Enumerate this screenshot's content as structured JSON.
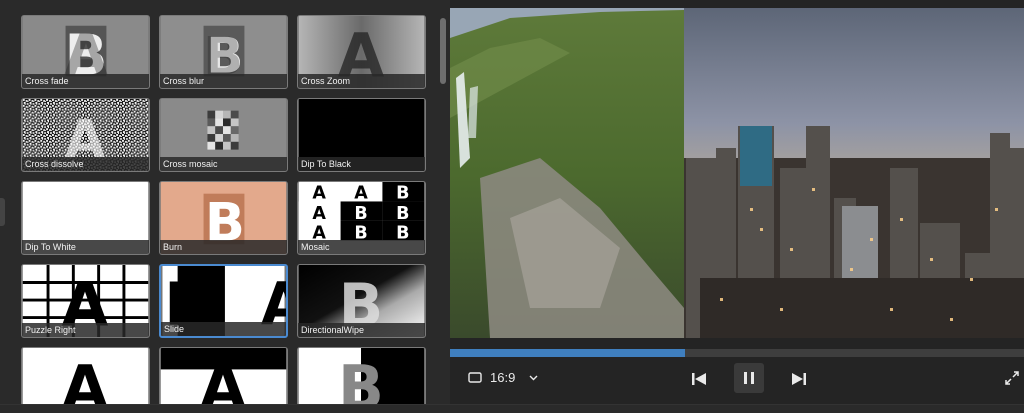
{
  "transitions": [
    {
      "label": "Cross fade",
      "selected": false
    },
    {
      "label": "Cross blur",
      "selected": false
    },
    {
      "label": "Cross Zoom",
      "selected": false
    },
    {
      "label": "Cross dissolve",
      "selected": false
    },
    {
      "label": "Cross mosaic",
      "selected": false
    },
    {
      "label": "Dip To Black",
      "selected": false
    },
    {
      "label": "Dip To White",
      "selected": false
    },
    {
      "label": "Burn",
      "selected": false
    },
    {
      "label": "Mosaic",
      "selected": false
    },
    {
      "label": "Puzzle Right",
      "selected": false
    },
    {
      "label": "Slide",
      "selected": true
    },
    {
      "label": "DirectionalWipe",
      "selected": false
    }
  ],
  "player": {
    "aspect_ratio": "16:9",
    "progress_fraction": 0.41
  },
  "colors": {
    "accent": "#3f7fbf",
    "selected_border": "#4a8ad0",
    "burn_tile": "#e3a98c"
  }
}
